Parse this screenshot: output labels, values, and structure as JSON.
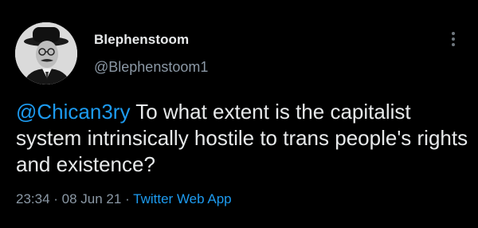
{
  "tweet": {
    "display_name": "Blephenstoom",
    "handle": "@Blephenstoom1",
    "mention": "@Chican3ry",
    "body": " To what extent is the capitalist system intrinsically hostile to trans people's rights and existence?",
    "time": "23:34",
    "separator_1": " · ",
    "date": "08 Jun 21",
    "separator_2": " · ",
    "source": "Twitter Web App"
  },
  "icons": {
    "avatar": "profile-photo",
    "more": "more-vertical-icon"
  },
  "colors": {
    "background": "#000000",
    "text": "#e7e9ea",
    "secondary": "#8b98a5",
    "accent": "#1d9bf0"
  }
}
